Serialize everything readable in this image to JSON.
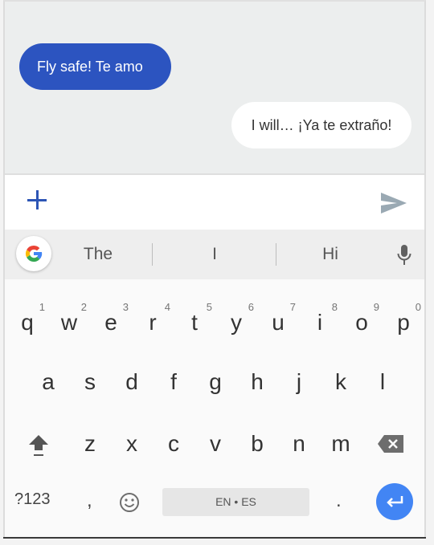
{
  "chat": {
    "messages": [
      {
        "direction": "incoming",
        "text": "Fly safe! Te amo"
      },
      {
        "direction": "outgoing",
        "text": "I will… ¡Ya te extraño!"
      }
    ]
  },
  "compose": {
    "add_icon": "plus-icon",
    "send_icon": "send-icon",
    "input_value": "",
    "accent_color": "#2c54c0"
  },
  "suggestions": {
    "logo_icon": "google-g-icon",
    "items": [
      "The",
      "I",
      "Hi"
    ],
    "mic_icon": "microphone-icon"
  },
  "keyboard": {
    "row1": [
      {
        "key": "q",
        "hint": "1"
      },
      {
        "key": "w",
        "hint": "2"
      },
      {
        "key": "e",
        "hint": "3"
      },
      {
        "key": "r",
        "hint": "4"
      },
      {
        "key": "t",
        "hint": "5"
      },
      {
        "key": "y",
        "hint": "6"
      },
      {
        "key": "u",
        "hint": "7"
      },
      {
        "key": "i",
        "hint": "8"
      },
      {
        "key": "o",
        "hint": "9"
      },
      {
        "key": "p",
        "hint": "0"
      }
    ],
    "row2": [
      "a",
      "s",
      "d",
      "f",
      "g",
      "h",
      "j",
      "k",
      "l"
    ],
    "row3": [
      "z",
      "x",
      "c",
      "v",
      "b",
      "n",
      "m"
    ],
    "shift_icon": "shift-icon",
    "backspace_icon": "backspace-icon",
    "symbols_label": "?123",
    "comma_label": ",",
    "emoji_icon": "emoji-icon",
    "space_label": "EN • ES",
    "period_label": ".",
    "enter_icon": "enter-icon",
    "enter_color": "#4285f4"
  }
}
